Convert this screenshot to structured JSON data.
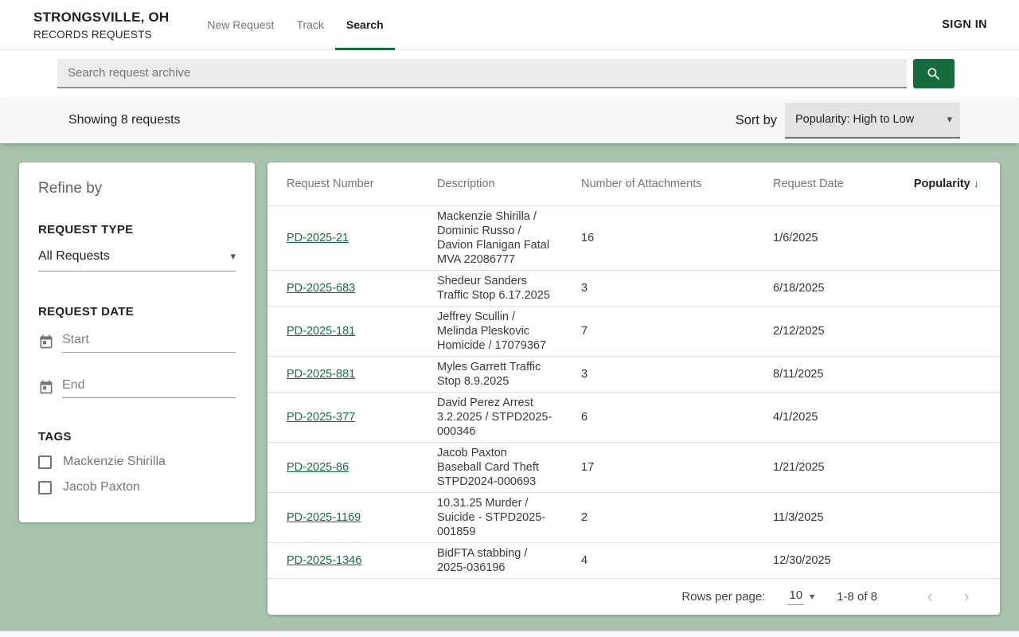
{
  "header": {
    "site_title": "STRONGSVILLE, OH",
    "site_subtitle": "RECORDS REQUESTS",
    "nav": [
      {
        "label": "New Request",
        "active": false
      },
      {
        "label": "Track",
        "active": false
      },
      {
        "label": "Search",
        "active": true
      }
    ],
    "sign_in_label": "SIGN IN"
  },
  "search": {
    "placeholder": "Search request archive",
    "value": ""
  },
  "results_bar": {
    "showing_text": "Showing 8 requests",
    "sort_by_label": "Sort by",
    "sort_value": "Popularity: High to Low"
  },
  "sidebar": {
    "title": "Refine by",
    "request_type": {
      "heading": "REQUEST TYPE",
      "value": "All Requests"
    },
    "request_date": {
      "heading": "REQUEST DATE",
      "start_placeholder": "Start",
      "end_placeholder": "End"
    },
    "tags": {
      "heading": "TAGS",
      "items": [
        {
          "label": "Mackenzie Shirilla",
          "checked": false
        },
        {
          "label": "Jacob Paxton",
          "checked": false
        }
      ]
    }
  },
  "table": {
    "columns": [
      "Request Number",
      "Description",
      "Number of Attachments",
      "Request Date",
      "Popularity"
    ],
    "sort_column": "Popularity",
    "sort_direction": "desc",
    "rows": [
      {
        "request_number": "PD-2025-21",
        "description": "Mackenzie Shirilla / Dominic Russo / Davion Flanigan Fatal MVA 22086777",
        "attachments": "16",
        "request_date": "1/6/2025"
      },
      {
        "request_number": "PD-2025-683",
        "description": "Shedeur Sanders Traffic Stop 6.17.2025",
        "attachments": "3",
        "request_date": "6/18/2025"
      },
      {
        "request_number": "PD-2025-181",
        "description": "Jeffrey Scullin / Melinda Pleskovic Homicide / 17079367",
        "attachments": "7",
        "request_date": "2/12/2025"
      },
      {
        "request_number": "PD-2025-881",
        "description": "Myles Garrett Traffic Stop 8.9.2025",
        "attachments": "3",
        "request_date": "8/11/2025"
      },
      {
        "request_number": "PD-2025-377",
        "description": "David Perez Arrest 3.2.2025 / STPD2025-000346",
        "attachments": "6",
        "request_date": "4/1/2025"
      },
      {
        "request_number": "PD-2025-86",
        "description": "Jacob Paxton Baseball Card Theft STPD2024-000693",
        "attachments": "17",
        "request_date": "1/21/2025"
      },
      {
        "request_number": "PD-2025-1169",
        "description": "10.31.25 Murder / Suicide - STPD2025-001859",
        "attachments": "2",
        "request_date": "11/3/2025"
      },
      {
        "request_number": "PD-2025-1346",
        "description": "BidFTA stabbing / 2025-036196",
        "attachments": "4",
        "request_date": "12/30/2025"
      }
    ],
    "pagination": {
      "rows_per_page_label": "Rows per page:",
      "rows_per_page_value": "10",
      "range_text": "1-8 of 8"
    }
  },
  "icons": {
    "dropdown_caret": "▾",
    "sort_desc_arrow": "↓",
    "chevron_left": "‹",
    "chevron_right": "›"
  },
  "colors": {
    "primary_green": "#176C3E",
    "page_background_sage": "#A8C3AC",
    "bar_background": "#F6F8F6",
    "input_gray": "#ECECEC",
    "select_gray": "#E3E3E3",
    "muted_text": "#757575",
    "divider": "#E0E0E0"
  }
}
